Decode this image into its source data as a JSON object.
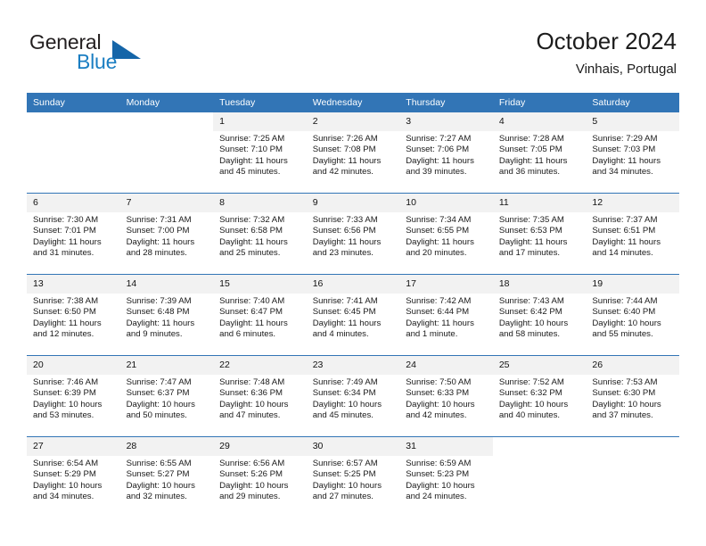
{
  "brand": {
    "line1": "General",
    "line2": "Blue",
    "triangle_color": "#1565a8",
    "blue_color": "#1b7ec2"
  },
  "header": {
    "title": "October 2024",
    "subtitle": "Vinhais, Portugal",
    "header_bg": "#3275b6",
    "daynum_bg": "#f2f2f2"
  },
  "weekdays": [
    "Sunday",
    "Monday",
    "Tuesday",
    "Wednesday",
    "Thursday",
    "Friday",
    "Saturday"
  ],
  "labels": {
    "sunrise": "Sunrise:",
    "sunset": "Sunset:",
    "daylight": "Daylight:"
  },
  "weeks": [
    [
      {
        "day": "",
        "empty": true
      },
      {
        "day": "",
        "empty": true
      },
      {
        "day": "1",
        "sunrise": "Sunrise: 7:25 AM",
        "sunset": "Sunset: 7:10 PM",
        "daylight1": "Daylight: 11 hours",
        "daylight2": "and 45 minutes."
      },
      {
        "day": "2",
        "sunrise": "Sunrise: 7:26 AM",
        "sunset": "Sunset: 7:08 PM",
        "daylight1": "Daylight: 11 hours",
        "daylight2": "and 42 minutes."
      },
      {
        "day": "3",
        "sunrise": "Sunrise: 7:27 AM",
        "sunset": "Sunset: 7:06 PM",
        "daylight1": "Daylight: 11 hours",
        "daylight2": "and 39 minutes."
      },
      {
        "day": "4",
        "sunrise": "Sunrise: 7:28 AM",
        "sunset": "Sunset: 7:05 PM",
        "daylight1": "Daylight: 11 hours",
        "daylight2": "and 36 minutes."
      },
      {
        "day": "5",
        "sunrise": "Sunrise: 7:29 AM",
        "sunset": "Sunset: 7:03 PM",
        "daylight1": "Daylight: 11 hours",
        "daylight2": "and 34 minutes."
      }
    ],
    [
      {
        "day": "6",
        "sunrise": "Sunrise: 7:30 AM",
        "sunset": "Sunset: 7:01 PM",
        "daylight1": "Daylight: 11 hours",
        "daylight2": "and 31 minutes."
      },
      {
        "day": "7",
        "sunrise": "Sunrise: 7:31 AM",
        "sunset": "Sunset: 7:00 PM",
        "daylight1": "Daylight: 11 hours",
        "daylight2": "and 28 minutes."
      },
      {
        "day": "8",
        "sunrise": "Sunrise: 7:32 AM",
        "sunset": "Sunset: 6:58 PM",
        "daylight1": "Daylight: 11 hours",
        "daylight2": "and 25 minutes."
      },
      {
        "day": "9",
        "sunrise": "Sunrise: 7:33 AM",
        "sunset": "Sunset: 6:56 PM",
        "daylight1": "Daylight: 11 hours",
        "daylight2": "and 23 minutes."
      },
      {
        "day": "10",
        "sunrise": "Sunrise: 7:34 AM",
        "sunset": "Sunset: 6:55 PM",
        "daylight1": "Daylight: 11 hours",
        "daylight2": "and 20 minutes."
      },
      {
        "day": "11",
        "sunrise": "Sunrise: 7:35 AM",
        "sunset": "Sunset: 6:53 PM",
        "daylight1": "Daylight: 11 hours",
        "daylight2": "and 17 minutes."
      },
      {
        "day": "12",
        "sunrise": "Sunrise: 7:37 AM",
        "sunset": "Sunset: 6:51 PM",
        "daylight1": "Daylight: 11 hours",
        "daylight2": "and 14 minutes."
      }
    ],
    [
      {
        "day": "13",
        "sunrise": "Sunrise: 7:38 AM",
        "sunset": "Sunset: 6:50 PM",
        "daylight1": "Daylight: 11 hours",
        "daylight2": "and 12 minutes."
      },
      {
        "day": "14",
        "sunrise": "Sunrise: 7:39 AM",
        "sunset": "Sunset: 6:48 PM",
        "daylight1": "Daylight: 11 hours",
        "daylight2": "and 9 minutes."
      },
      {
        "day": "15",
        "sunrise": "Sunrise: 7:40 AM",
        "sunset": "Sunset: 6:47 PM",
        "daylight1": "Daylight: 11 hours",
        "daylight2": "and 6 minutes."
      },
      {
        "day": "16",
        "sunrise": "Sunrise: 7:41 AM",
        "sunset": "Sunset: 6:45 PM",
        "daylight1": "Daylight: 11 hours",
        "daylight2": "and 4 minutes."
      },
      {
        "day": "17",
        "sunrise": "Sunrise: 7:42 AM",
        "sunset": "Sunset: 6:44 PM",
        "daylight1": "Daylight: 11 hours",
        "daylight2": "and 1 minute."
      },
      {
        "day": "18",
        "sunrise": "Sunrise: 7:43 AM",
        "sunset": "Sunset: 6:42 PM",
        "daylight1": "Daylight: 10 hours",
        "daylight2": "and 58 minutes."
      },
      {
        "day": "19",
        "sunrise": "Sunrise: 7:44 AM",
        "sunset": "Sunset: 6:40 PM",
        "daylight1": "Daylight: 10 hours",
        "daylight2": "and 55 minutes."
      }
    ],
    [
      {
        "day": "20",
        "sunrise": "Sunrise: 7:46 AM",
        "sunset": "Sunset: 6:39 PM",
        "daylight1": "Daylight: 10 hours",
        "daylight2": "and 53 minutes."
      },
      {
        "day": "21",
        "sunrise": "Sunrise: 7:47 AM",
        "sunset": "Sunset: 6:37 PM",
        "daylight1": "Daylight: 10 hours",
        "daylight2": "and 50 minutes."
      },
      {
        "day": "22",
        "sunrise": "Sunrise: 7:48 AM",
        "sunset": "Sunset: 6:36 PM",
        "daylight1": "Daylight: 10 hours",
        "daylight2": "and 47 minutes."
      },
      {
        "day": "23",
        "sunrise": "Sunrise: 7:49 AM",
        "sunset": "Sunset: 6:34 PM",
        "daylight1": "Daylight: 10 hours",
        "daylight2": "and 45 minutes."
      },
      {
        "day": "24",
        "sunrise": "Sunrise: 7:50 AM",
        "sunset": "Sunset: 6:33 PM",
        "daylight1": "Daylight: 10 hours",
        "daylight2": "and 42 minutes."
      },
      {
        "day": "25",
        "sunrise": "Sunrise: 7:52 AM",
        "sunset": "Sunset: 6:32 PM",
        "daylight1": "Daylight: 10 hours",
        "daylight2": "and 40 minutes."
      },
      {
        "day": "26",
        "sunrise": "Sunrise: 7:53 AM",
        "sunset": "Sunset: 6:30 PM",
        "daylight1": "Daylight: 10 hours",
        "daylight2": "and 37 minutes."
      }
    ],
    [
      {
        "day": "27",
        "sunrise": "Sunrise: 6:54 AM",
        "sunset": "Sunset: 5:29 PM",
        "daylight1": "Daylight: 10 hours",
        "daylight2": "and 34 minutes."
      },
      {
        "day": "28",
        "sunrise": "Sunrise: 6:55 AM",
        "sunset": "Sunset: 5:27 PM",
        "daylight1": "Daylight: 10 hours",
        "daylight2": "and 32 minutes."
      },
      {
        "day": "29",
        "sunrise": "Sunrise: 6:56 AM",
        "sunset": "Sunset: 5:26 PM",
        "daylight1": "Daylight: 10 hours",
        "daylight2": "and 29 minutes."
      },
      {
        "day": "30",
        "sunrise": "Sunrise: 6:57 AM",
        "sunset": "Sunset: 5:25 PM",
        "daylight1": "Daylight: 10 hours",
        "daylight2": "and 27 minutes."
      },
      {
        "day": "31",
        "sunrise": "Sunrise: 6:59 AM",
        "sunset": "Sunset: 5:23 PM",
        "daylight1": "Daylight: 10 hours",
        "daylight2": "and 24 minutes."
      },
      {
        "day": "",
        "empty": true
      },
      {
        "day": "",
        "empty": true
      }
    ]
  ]
}
